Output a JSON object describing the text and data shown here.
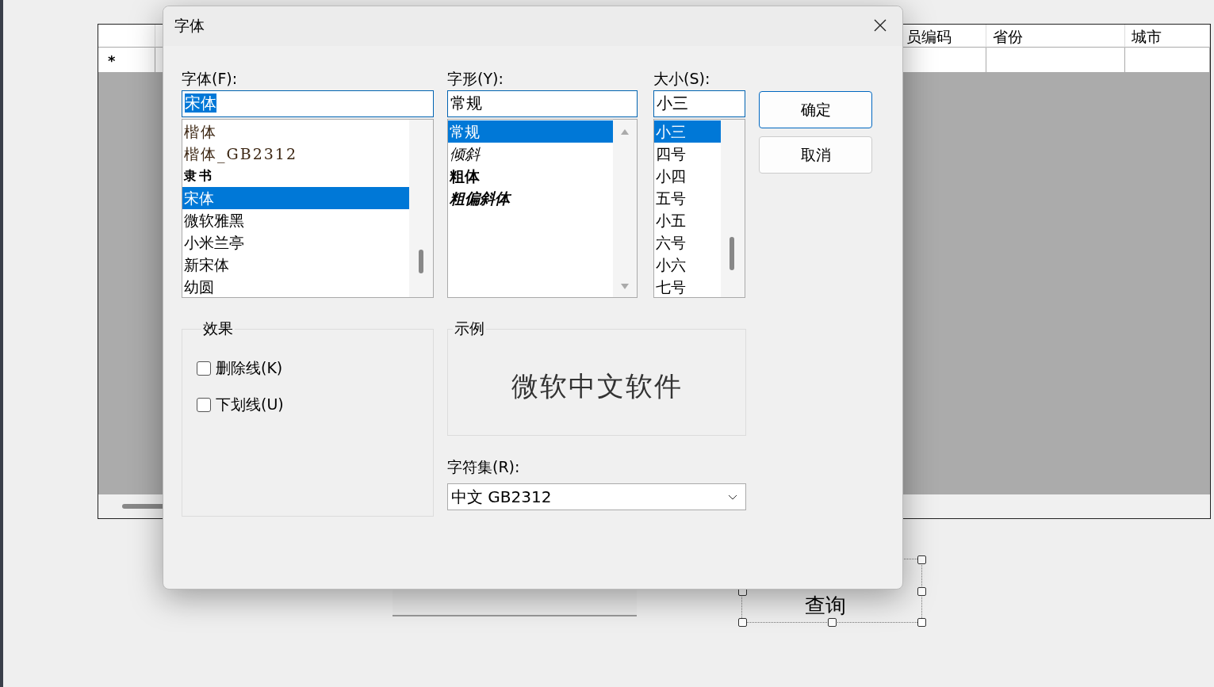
{
  "background_grid": {
    "columns": [
      {},
      {},
      {
        "label": "员编码"
      },
      {
        "label": "省份"
      },
      {
        "label": "城市"
      }
    ],
    "new_row_marker": "*"
  },
  "designer_button": {
    "label": "查询"
  },
  "dialog": {
    "title": "字体",
    "font": {
      "label": "字体(F):",
      "value": "宋体",
      "text_selected": true,
      "items": [
        {
          "label": "楷体",
          "kind": "kai",
          "selected": false
        },
        {
          "label": "楷体_GB2312",
          "kind": "kai",
          "selected": false
        },
        {
          "label": "隶书",
          "kind": "li",
          "selected": false
        },
        {
          "label": "宋体",
          "kind": "song",
          "selected": true
        },
        {
          "label": "微软雅黑",
          "kind": "hei",
          "selected": false
        },
        {
          "label": "小米兰亭",
          "kind": "hei",
          "selected": false
        },
        {
          "label": "新宋体",
          "kind": "song",
          "selected": false
        },
        {
          "label": "幼圆",
          "kind": "hei",
          "selected": false
        }
      ]
    },
    "style": {
      "label": "字形(Y):",
      "value": "常规",
      "items": [
        {
          "label": "常规",
          "kind": "regular",
          "selected": true
        },
        {
          "label": "倾斜",
          "kind": "italic",
          "selected": false
        },
        {
          "label": "粗体",
          "kind": "bold",
          "selected": false
        },
        {
          "label": "粗偏斜体",
          "kind": "bold-italic",
          "selected": false
        }
      ]
    },
    "size": {
      "label": "大小(S):",
      "value": "小三",
      "items": [
        {
          "label": "小三",
          "selected": true
        },
        {
          "label": "四号",
          "selected": false
        },
        {
          "label": "小四",
          "selected": false
        },
        {
          "label": "五号",
          "selected": false
        },
        {
          "label": "小五",
          "selected": false
        },
        {
          "label": "六号",
          "selected": false
        },
        {
          "label": "小六",
          "selected": false
        },
        {
          "label": "七号",
          "selected": false
        }
      ]
    },
    "buttons": [
      {
        "label": "确定",
        "default": true
      },
      {
        "label": "取消",
        "default": false
      }
    ],
    "effects": {
      "title": "效果",
      "options": [
        {
          "label": "删除线(K)",
          "checked": false
        },
        {
          "label": "下划线(U)",
          "checked": false
        }
      ]
    },
    "sample": {
      "title": "示例",
      "text": "微软中文软件"
    },
    "charset": {
      "label": "字符集(R):",
      "value": "中文 GB2312"
    }
  }
}
